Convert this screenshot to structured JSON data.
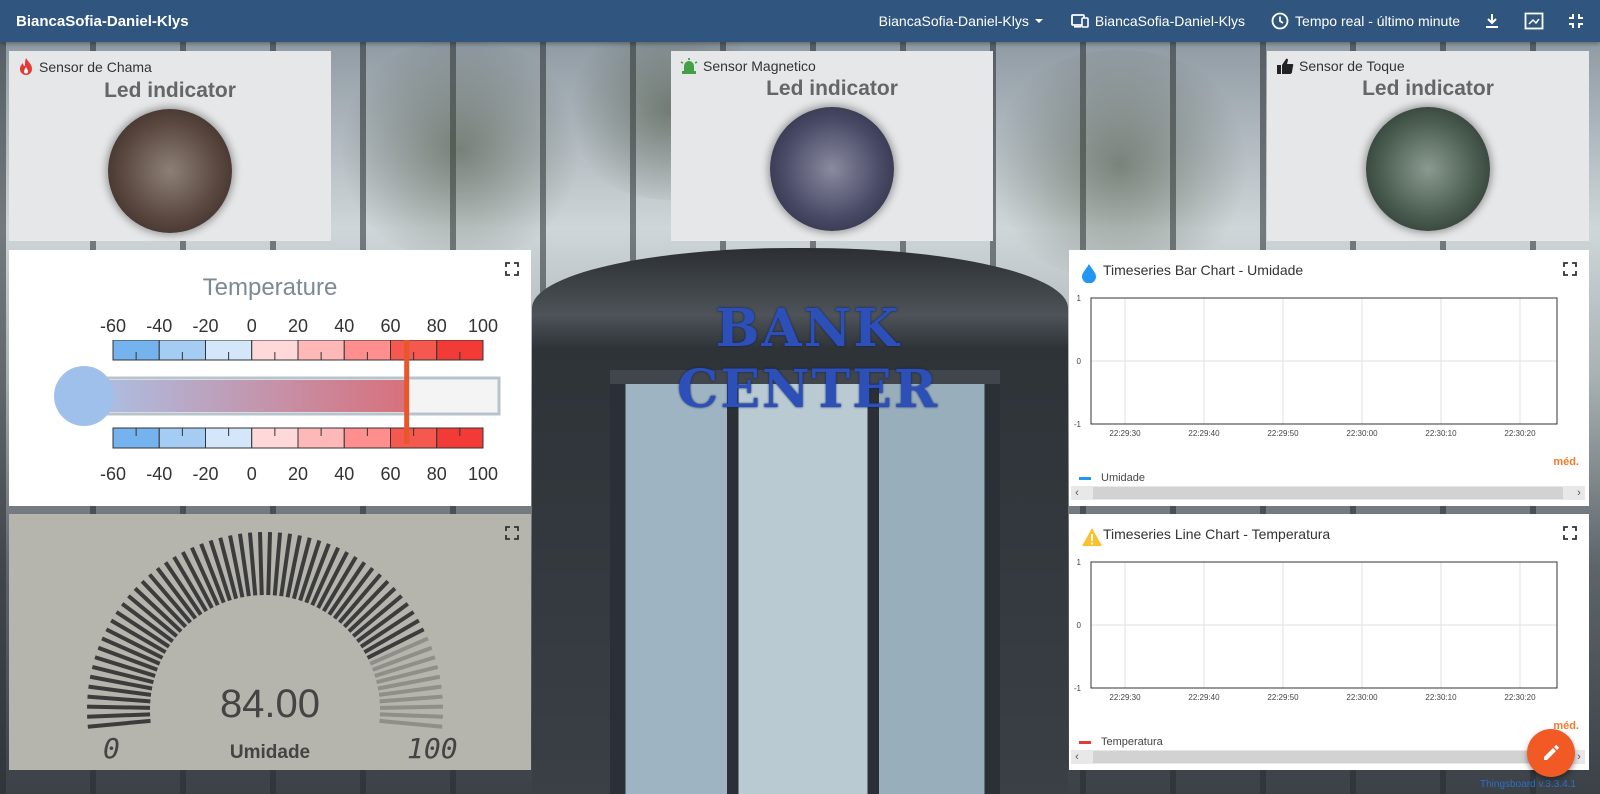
{
  "topbar": {
    "title": "BiancaSofia-Daniel-Klys",
    "dashboard_select": "BiancaSofia-Daniel-Klys",
    "entity_alias": "BiancaSofia-Daniel-Klys",
    "timewindow": "Tempo real - último minute",
    "icons": [
      "download-icon",
      "fullscreen-icon",
      "exit-fullscreen-icon"
    ]
  },
  "background": {
    "sign_text": "BANK CENTER"
  },
  "leds": [
    {
      "label": "Sensor de Chama",
      "title": "Led indicator",
      "icon": "fire-icon",
      "icon_color": "#e53935",
      "led_color": "#4a3b34"
    },
    {
      "label": "Sensor Magnetico",
      "title": "Led indicator",
      "icon": "alarm-light-icon",
      "icon_color": "#43a047",
      "led_color": "#3a3b52"
    },
    {
      "label": "Sensor de Toque",
      "title": "Led indicator",
      "icon": "hand-touch-icon",
      "icon_color": "#222222",
      "led_color": "#3e4a43"
    }
  ],
  "temperature": {
    "title": "Temperature",
    "ticks": [
      "-60",
      "-40",
      "-20",
      "0",
      "20",
      "40",
      "60",
      "80",
      "100"
    ],
    "value": 67,
    "min": -60,
    "max": 100
  },
  "humidity_gauge": {
    "value": "84.00",
    "numeric_value": 84,
    "label": "Umidade",
    "min_label": "0",
    "max_label": "100"
  },
  "bar_chart": {
    "title": "Timeseries Bar Chart - Umidade",
    "icon": "water-drop-icon",
    "legend": "Umidade",
    "legend_color": "#2196f3",
    "avg_label": "méd.",
    "y_ticks": [
      "1",
      "0",
      "-1"
    ],
    "x_ticks": [
      "22:29:30",
      "22:29:40",
      "22:29:50",
      "22:30:00",
      "22:30:10",
      "22:30:20"
    ]
  },
  "line_chart": {
    "title": "Timeseries Line Chart - Temperatura",
    "icon": "warning-icon",
    "legend": "Temperatura",
    "legend_color": "#e53935",
    "avg_label": "méd.",
    "y_ticks": [
      "1",
      "0",
      "-1"
    ],
    "x_ticks": [
      "22:29:30",
      "22:29:40",
      "22:29:50",
      "22:30:00",
      "22:30:10",
      "22:30:20"
    ]
  },
  "footer": {
    "text": "Thingsboard v.3.3.4.1"
  }
}
